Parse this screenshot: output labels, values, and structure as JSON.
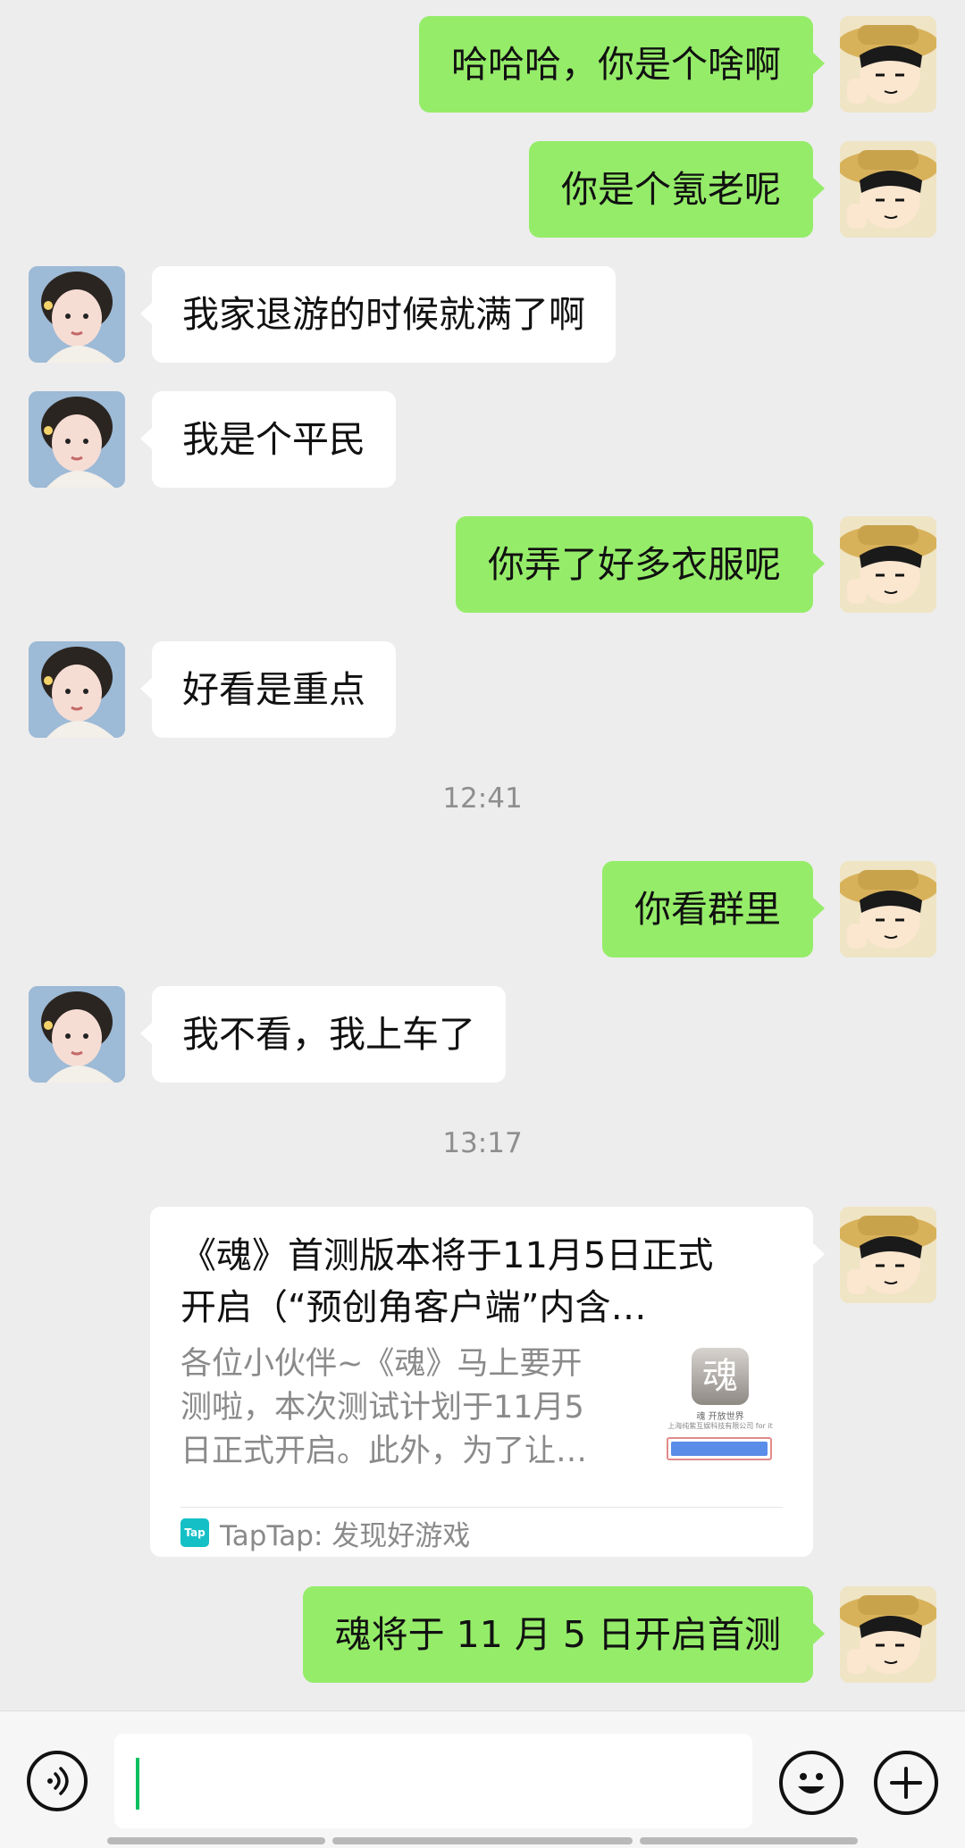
{
  "messages": [
    {
      "from": "me",
      "text": "哈哈哈，你是个啥啊"
    },
    {
      "from": "me",
      "text": "你是个氪老呢"
    },
    {
      "from": "peer",
      "text": "我家退游的时候就满了啊"
    },
    {
      "from": "peer",
      "text": "我是个平民"
    },
    {
      "from": "me",
      "text": "你弄了好多衣服呢"
    },
    {
      "from": "peer",
      "text": "好看是重点"
    },
    {
      "from": "me",
      "text": "你看群里"
    },
    {
      "from": "peer",
      "text": "我不看，我上车了"
    },
    {
      "from": "me",
      "text": "魂将于 11 月 5 日开启首测"
    }
  ],
  "timestamps": [
    "12:41",
    "13:17"
  ],
  "link_card": {
    "title": "《魂》首测版本将于11月5日正式\n开启（“预创角客户端”内含…",
    "description": "各位小伙伴~《魂》马上要开\n测啦，本次测试计划于11月5\n日正式开启。此外，为了让…",
    "thumb_glyph": "魂",
    "thumb_caption_1": "魂 开放世界",
    "thumb_caption_2": "上海纯紫互娱科技有限公司 for it",
    "source_logo": "Tap",
    "source": "TapTap: 发现好游戏"
  },
  "input": {
    "value": ""
  },
  "colors": {
    "sent_bubble": "#95ec69",
    "received_bubble": "#ffffff",
    "background": "#ededed",
    "caret": "#07c160"
  },
  "icons": [
    "voice-icon",
    "emoji-icon",
    "plus-icon"
  ]
}
